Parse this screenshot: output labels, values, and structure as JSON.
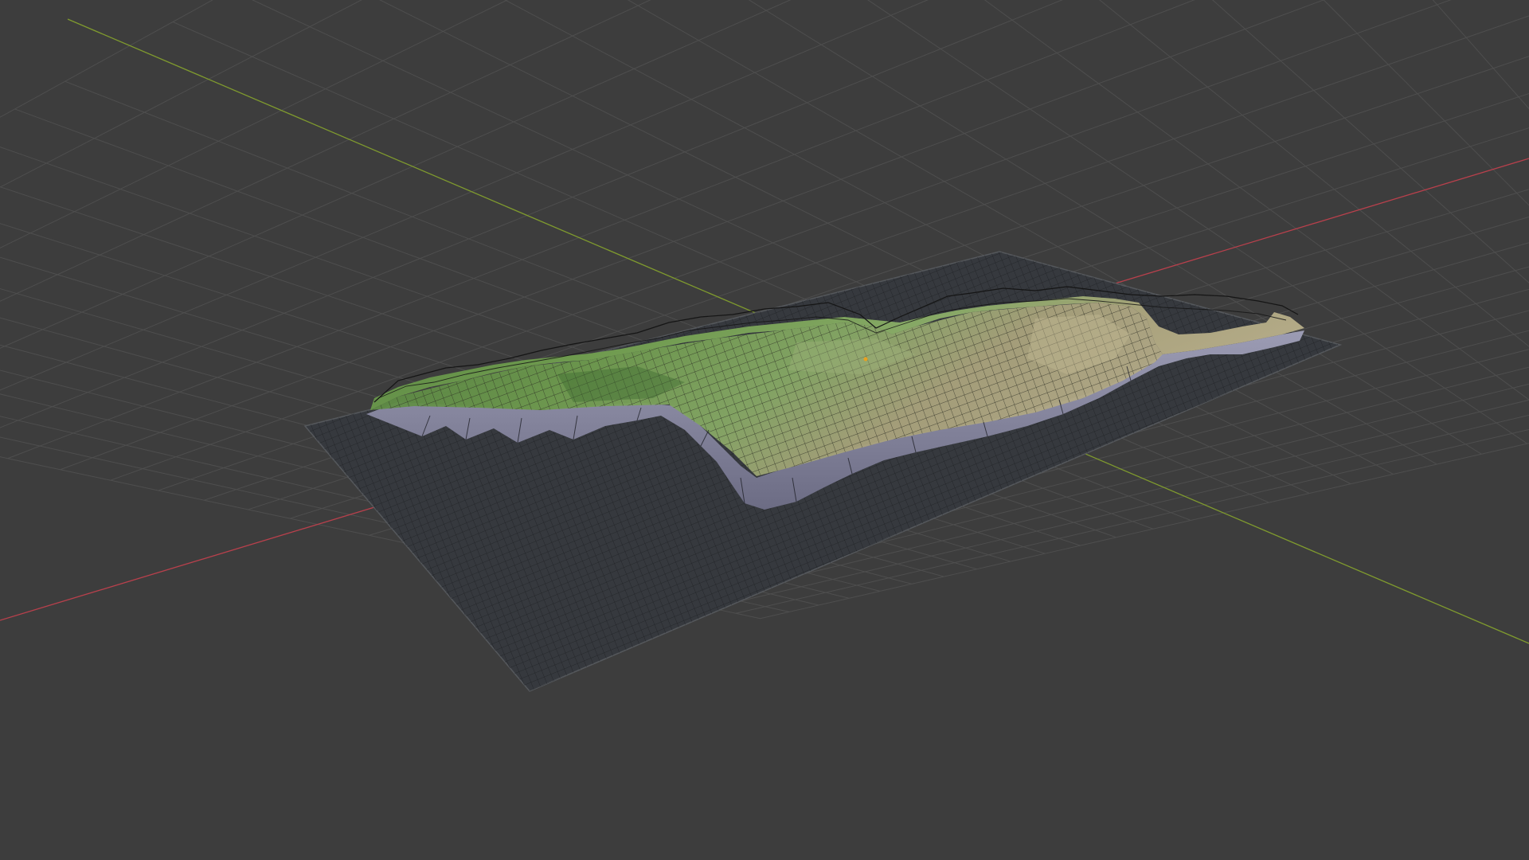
{
  "viewport": {
    "background_color": "#3d3d3d",
    "grid_color": "#4e4e4e",
    "x_axis_color": "#b8404c",
    "y_axis_color": "#7f9a2e",
    "view_mode": "perspective",
    "shading": "solid",
    "overlay": "wireframe"
  },
  "scene": {
    "object": "terrain-mesh",
    "ground_plane_color": "#36393e",
    "wire_color": "#1b1c1e",
    "terrain_colors": {
      "lowland": "#5c8a43",
      "midland": "#7da35c",
      "upland": "#a8a07a",
      "cliff": "#8e8ea8",
      "cliff_shadow": "#6b6b80"
    },
    "origin_marker_color": "#e8a020"
  }
}
